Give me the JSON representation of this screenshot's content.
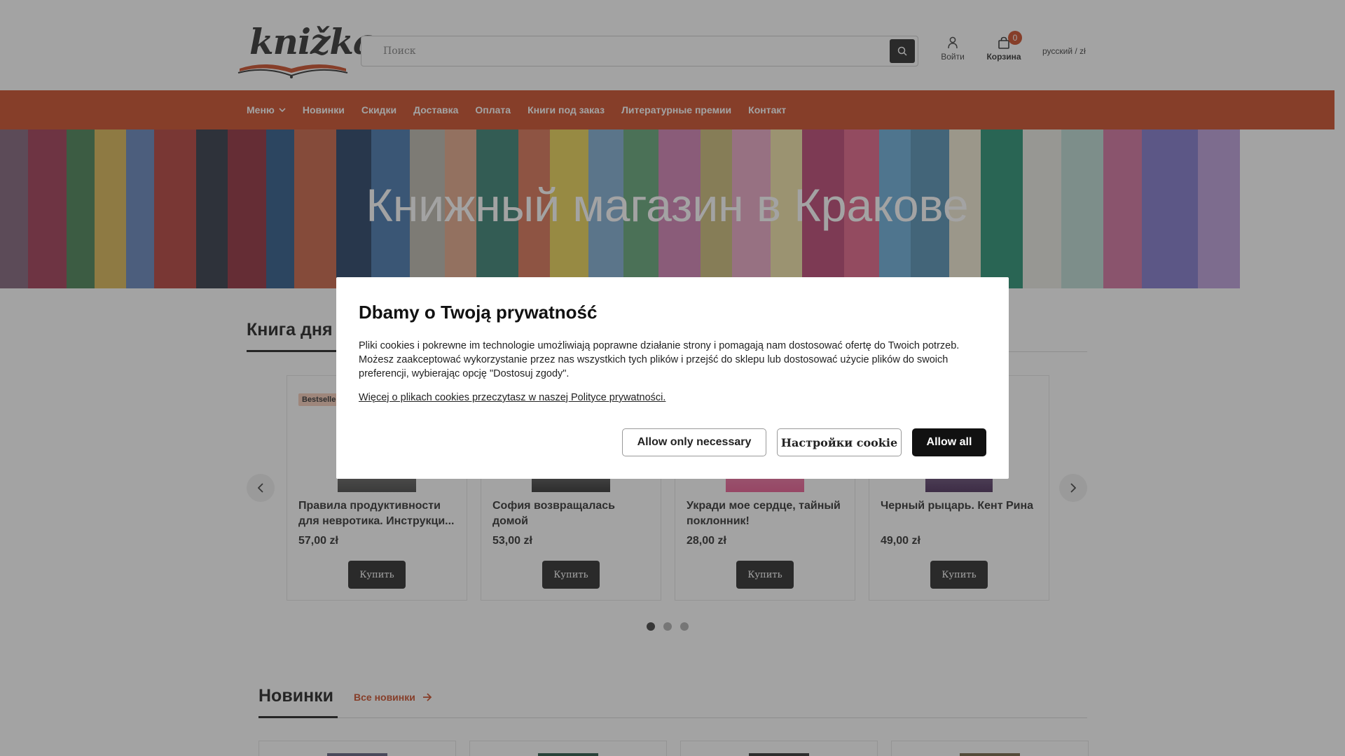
{
  "header": {
    "logo_text": "knižka",
    "search_placeholder": "Поиск",
    "account_label": "Войти",
    "cart_label": "Корзина",
    "cart_count": "0",
    "lang_currency": "русский / zł"
  },
  "nav": {
    "items": [
      "Меню",
      "Новинки",
      "Скидки",
      "Доставка",
      "Оплата",
      "Книги под заказ",
      "Литературные премии",
      "Контакт"
    ]
  },
  "hero": {
    "title": "Книжный магазин в Кракове"
  },
  "book_of_day": {
    "title": "Книга дня",
    "products": [
      {
        "badge": "Bestseller",
        "title": "Правила продуктивности для невротика. Инструкци...",
        "price": "57,00 zł",
        "buy_label": "Купить"
      },
      {
        "badge": "",
        "title": "София возвращалась домой",
        "price": "53,00 zł",
        "buy_label": "Купить"
      },
      {
        "badge": "",
        "title": "Укради мое сердце, тайный поклонник!",
        "price": "28,00 zł",
        "buy_label": "Купить"
      },
      {
        "badge": "",
        "title": "Черный рыцарь. Кент Рина",
        "price": "49,00 zł",
        "buy_label": "Купить"
      }
    ],
    "pages": 3,
    "active_page": 1
  },
  "new_books": {
    "title": "Новинки",
    "all_link": "Все новинки"
  },
  "cookie_modal": {
    "title": "Dbamy o Twoją prywatność",
    "body": "Pliki cookies i pokrewne im technologie umożliwiają poprawne działanie strony i pomagają nam dostosować ofertę do Twoich potrzeb. Możesz zaakceptować wykorzystanie przez nas wszystkich tych plików i przejść do sklepu lub dostosować użycie plików do swoich preferencji, wybierając opcję \"Dostosuj zgody\".",
    "policy_link": "Więcej o plikach cookies przeczytasz w naszej Polityce prywatności.",
    "btn_necessary": "Allow only necessary",
    "btn_settings": "Настройки cookie",
    "btn_all": "Allow all"
  },
  "colors": {
    "accent": "#c8401a",
    "dark": "#1b1b1b"
  }
}
